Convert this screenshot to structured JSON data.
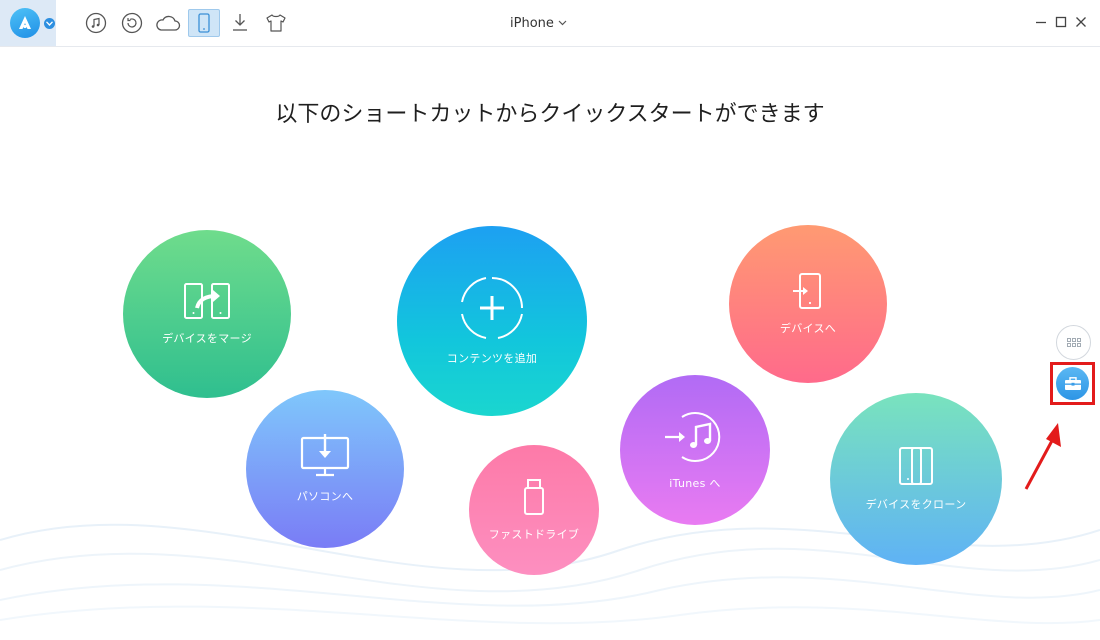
{
  "topbar": {
    "device_name": "iPhone",
    "icons": [
      "music-icon",
      "restore-icon",
      "cloud-icon",
      "phone-icon",
      "download-icon",
      "shirt-icon"
    ],
    "active_icon": "phone-icon"
  },
  "main": {
    "heading": "以下のショートカットからクイックスタートができます",
    "shortcuts": [
      {
        "id": "merge",
        "label": "デバイスをマージ",
        "icon": "merge-devices-icon"
      },
      {
        "id": "add",
        "label": "コンテンツを追加",
        "icon": "add-content-icon"
      },
      {
        "id": "todev",
        "label": "デバイスへ",
        "icon": "to-device-icon"
      },
      {
        "id": "pc",
        "label": "パソコンへ",
        "icon": "to-computer-icon"
      },
      {
        "id": "drive",
        "label": "ファストドライブ",
        "icon": "usb-drive-icon"
      },
      {
        "id": "itunes",
        "label": "iTunes へ",
        "icon": "to-itunes-icon"
      },
      {
        "id": "clone",
        "label": "デバイスをクローン",
        "icon": "clone-device-icon"
      }
    ]
  },
  "colors": {
    "accent": "#2d95e6",
    "highlight": "#e31b1b"
  }
}
